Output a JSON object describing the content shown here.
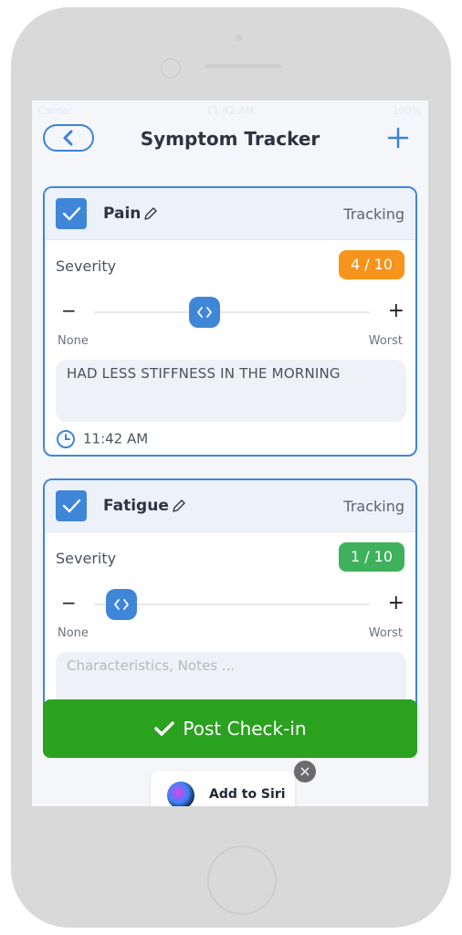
{
  "status_bar": {
    "carrier": "Carrier",
    "time": "11:42 AM",
    "battery": "100%"
  },
  "nav": {
    "title": "Symptom Tracker",
    "back_icon": "chevron-left-icon",
    "add_icon": "plus-icon"
  },
  "symptoms": [
    {
      "name": "Pain",
      "status": "Tracking",
      "checked": true,
      "severity_label": "Severity",
      "severity_value": 4,
      "severity_max": 10,
      "severity_text": "4 / 10",
      "severity_color": "#f7941d",
      "scale_min_label": "None",
      "scale_max_label": "Worst",
      "notes": "HAD LESS STIFFNESS IN THE MORNING",
      "notes_placeholder": "",
      "time": "11:42 AM"
    },
    {
      "name": "Fatigue",
      "status": "Tracking",
      "checked": true,
      "severity_label": "Severity",
      "severity_value": 1,
      "severity_max": 10,
      "severity_text": "1 / 10",
      "severity_color": "#3fb15c",
      "scale_min_label": "None",
      "scale_max_label": "Worst",
      "notes": "",
      "notes_placeholder": "Characteristics, Notes ..."
    }
  ],
  "post_button": {
    "label": "Post Check-in",
    "color": "#2aa11f"
  },
  "siri": {
    "label": "Add to Siri"
  },
  "accent_color": "#3f86d8"
}
